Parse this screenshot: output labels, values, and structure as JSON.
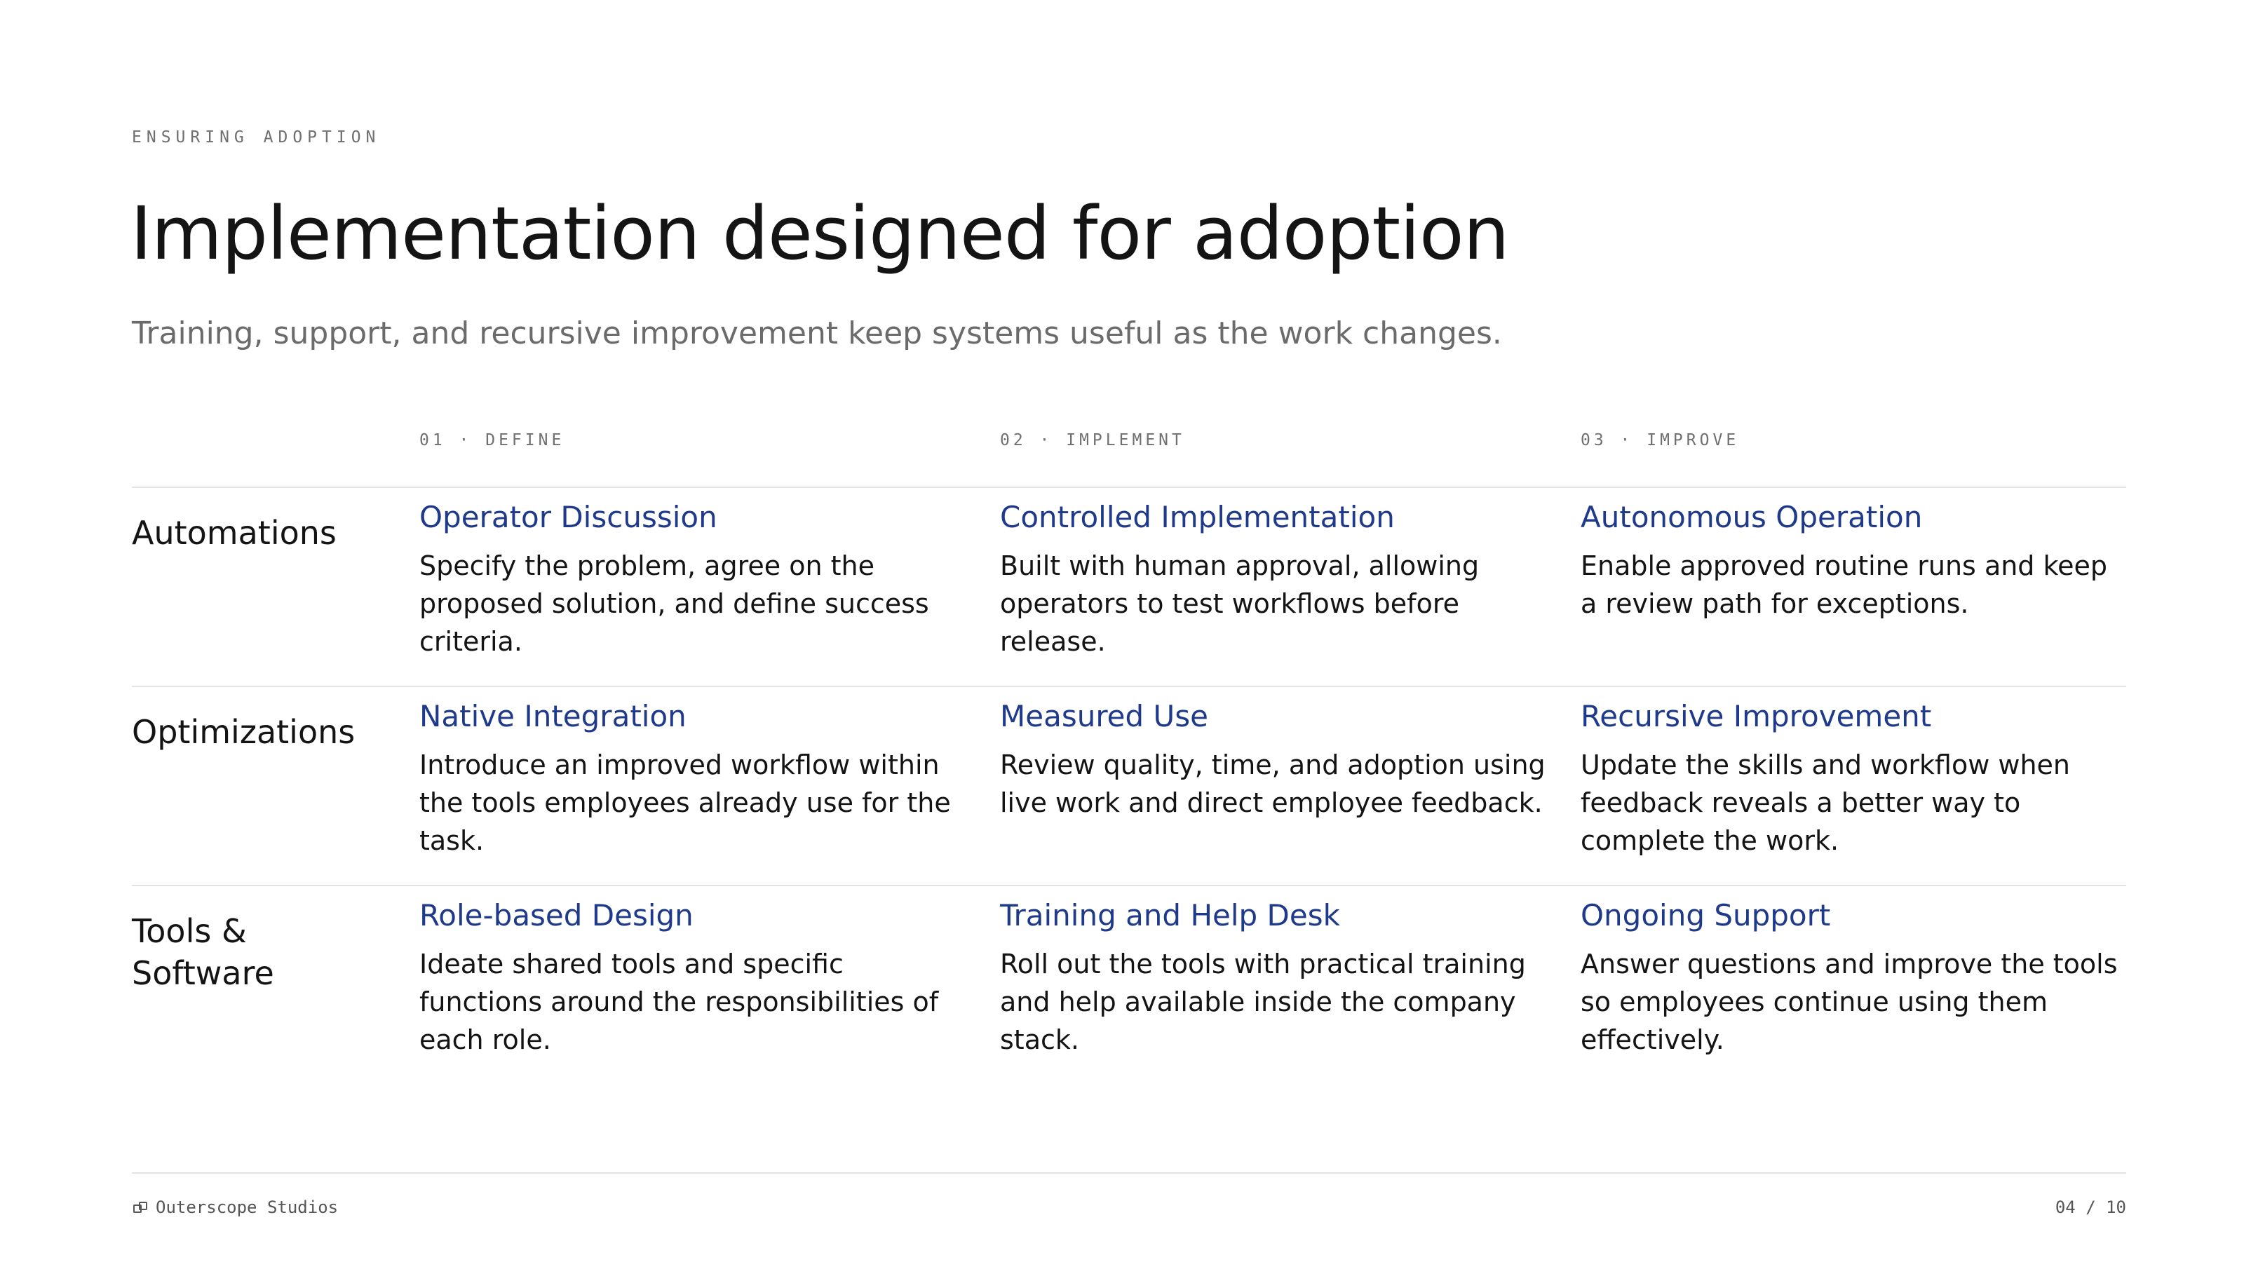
{
  "header": {
    "eyebrow": "ENSURING ADOPTION",
    "title": "Implementation designed for adoption",
    "subtitle": "Training, support, and recursive improvement keep systems useful as the work changes."
  },
  "phases": [
    {
      "label": "01 · DEFINE"
    },
    {
      "label": "02 · IMPLEMENT"
    },
    {
      "label": "03 · IMPROVE"
    }
  ],
  "rows": [
    {
      "label": "Automations",
      "cells": [
        {
          "title": "Operator Discussion",
          "body": "Specify the problem, agree on the proposed solution, and define success criteria."
        },
        {
          "title": "Controlled Implementation",
          "body": "Built with human approval, allowing operators to test workflows before release."
        },
        {
          "title": "Autonomous Operation",
          "body": "Enable approved routine runs and keep a review path for exceptions."
        }
      ]
    },
    {
      "label": "Optimizations",
      "cells": [
        {
          "title": "Native Integration",
          "body": "Introduce an improved workflow within the tools employees already use for the task."
        },
        {
          "title": "Measured Use",
          "body": "Review quality, time, and adoption using live work and direct employee feedback."
        },
        {
          "title": "Recursive Improvement",
          "body": "Update the skills and workflow when feedback reveals a better way to complete the work."
        }
      ]
    },
    {
      "label": "Tools & Software",
      "cells": [
        {
          "title": "Role-based Design",
          "body": "Ideate shared tools and specific functions around the responsibilities of each role."
        },
        {
          "title": "Training and Help Desk",
          "body": "Roll out the tools with practical training and help available inside the company stack."
        },
        {
          "title": "Ongoing Support",
          "body": "Answer questions and improve the tools so employees continue using them effectively."
        }
      ]
    }
  ],
  "footer": {
    "brand_icon": "link-icon",
    "brand": "Outerscope Studios",
    "page": "04 / 10"
  },
  "colors": {
    "accent": "#1f3a8a",
    "text": "#141414",
    "muted": "#6b6b6b",
    "rule": "#e4e4e4"
  }
}
